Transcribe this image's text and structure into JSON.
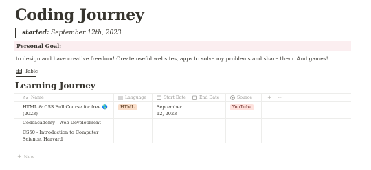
{
  "page": {
    "title": "Coding Journey"
  },
  "quote": {
    "label": "started:",
    "value": "September 12th, 2023"
  },
  "callout": {
    "heading": "Personal Goal:"
  },
  "goal": {
    "text": "to design and have creative freedom! Create useful websites, apps to solve my problems and share them. And games!"
  },
  "view": {
    "tab_label": "Table",
    "icon": "table-icon"
  },
  "database": {
    "title": "Learning Journey",
    "columns": [
      {
        "label": "Name",
        "icon": "text-icon"
      },
      {
        "label": "Language",
        "icon": "list-icon"
      },
      {
        "label": "Start Date",
        "icon": "calendar-icon"
      },
      {
        "label": "End Date",
        "icon": "calendar-icon"
      },
      {
        "label": "Source",
        "icon": "select-icon"
      }
    ],
    "add_property_label": "+",
    "more_label": "···",
    "rows": [
      {
        "name": "HTML & CSS Full Course for free 🌎 (2023)",
        "language": "HTML",
        "start_date": "September 12, 2023",
        "end_date": "",
        "source": "YouTube"
      },
      {
        "name": "Codeacademy - Web Development",
        "language": "",
        "start_date": "",
        "end_date": "",
        "source": ""
      },
      {
        "name": "CS50 - Introduction to Computer Science, Harvard",
        "language": "",
        "start_date": "",
        "end_date": "",
        "source": ""
      }
    ],
    "new_label": "New"
  },
  "colors": {
    "text": "#37352f",
    "muted": "#9b9a97",
    "callout_bg": "#fbeef0",
    "tag_html_bg": "#fadec9",
    "tag_youtube_bg": "#ffe2dd"
  }
}
